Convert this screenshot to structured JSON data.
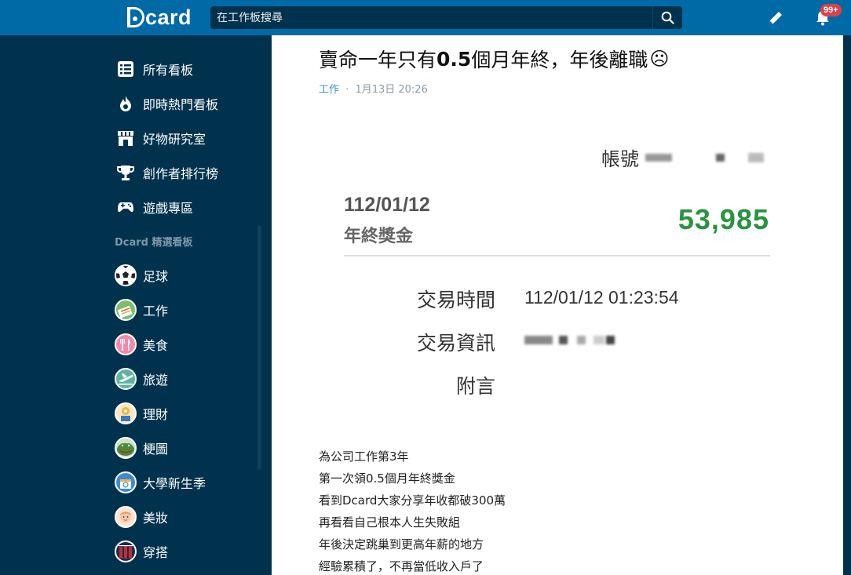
{
  "header": {
    "logo_text": "card",
    "search_placeholder": "在工作板搜尋",
    "notification_badge": "99+",
    "icons": [
      "search-icon",
      "pencil-icon",
      "bell-icon"
    ]
  },
  "sidebar": {
    "nav": [
      {
        "label": "所有看板",
        "icon": "list-icon"
      },
      {
        "label": "即時熱門看板",
        "icon": "flame-icon"
      },
      {
        "label": "好物研究室",
        "icon": "shop-icon"
      },
      {
        "label": "創作者排行榜",
        "icon": "trophy-icon"
      },
      {
        "label": "遊戲專區",
        "icon": "gamepad-icon"
      }
    ],
    "section_title": "Dcard 精選看板",
    "boards": [
      {
        "label": "足球",
        "color": "#222222"
      },
      {
        "label": "工作",
        "color": "#7bbf6a"
      },
      {
        "label": "美食",
        "color": "#f08aa8"
      },
      {
        "label": "旅遊",
        "color": "#5cb5a0"
      },
      {
        "label": "理財",
        "color": "#f3b23a"
      },
      {
        "label": "梗圖",
        "color": "#4a8a3a"
      },
      {
        "label": "大學新生季",
        "color": "#3a8ad6"
      },
      {
        "label": "美妝",
        "color": "#f6c9a8"
      },
      {
        "label": "穿搭",
        "color": "#c0302a"
      }
    ]
  },
  "post": {
    "title_prefix": "賣命一年只有",
    "title_number": "0.5",
    "title_suffix": "個月年終，年後離職",
    "title_emoji": "☹",
    "board": "工作",
    "separator": "·",
    "time": "1月13日 20:26",
    "receipt": {
      "account_label": "帳號",
      "date": "112/01/12",
      "type": "年終獎金",
      "amount": "53,985",
      "tx_time_label": "交易時間",
      "tx_time_value": "112/01/12 01:23:54",
      "tx_info_label": "交易資訊",
      "note_label": "附言"
    },
    "lines": [
      "為公司工作第3年",
      "第一次領0.5個月年終獎金",
      "看到Dcard大家分享年收都破300萬",
      "再看看自己根本人生失敗組",
      "年後決定跳巢到更高年薪的地方",
      "經驗累積了，不再當低收入戶了"
    ]
  }
}
